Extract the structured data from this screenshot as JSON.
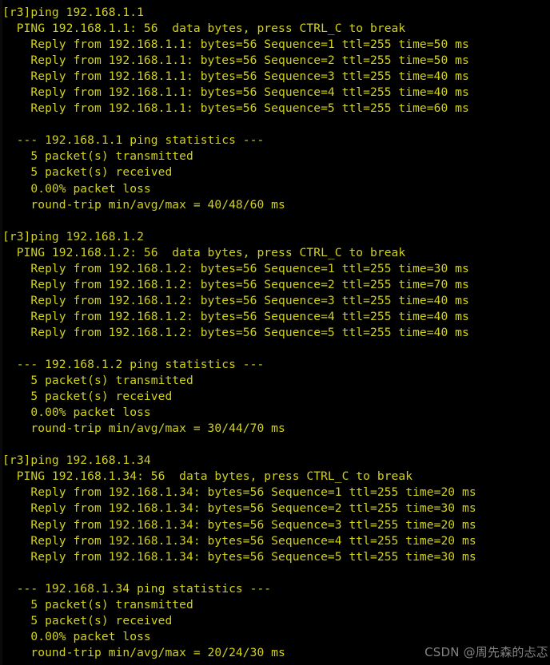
{
  "terminal": {
    "device_prompt": "[r3]",
    "foreground_color": "#d2d21d",
    "background_color": "#000000",
    "lines": [
      "[r3]ping 192.168.1.1",
      "  PING 192.168.1.1: 56  data bytes, press CTRL_C to break",
      "    Reply from 192.168.1.1: bytes=56 Sequence=1 ttl=255 time=50 ms",
      "    Reply from 192.168.1.1: bytes=56 Sequence=2 ttl=255 time=50 ms",
      "    Reply from 192.168.1.1: bytes=56 Sequence=3 ttl=255 time=40 ms",
      "    Reply from 192.168.1.1: bytes=56 Sequence=4 ttl=255 time=40 ms",
      "    Reply from 192.168.1.1: bytes=56 Sequence=5 ttl=255 time=60 ms",
      "",
      "  --- 192.168.1.1 ping statistics ---",
      "    5 packet(s) transmitted",
      "    5 packet(s) received",
      "    0.00% packet loss",
      "    round-trip min/avg/max = 40/48/60 ms",
      "",
      "[r3]ping 192.168.1.2",
      "  PING 192.168.1.2: 56  data bytes, press CTRL_C to break",
      "    Reply from 192.168.1.2: bytes=56 Sequence=1 ttl=255 time=30 ms",
      "    Reply from 192.168.1.2: bytes=56 Sequence=2 ttl=255 time=70 ms",
      "    Reply from 192.168.1.2: bytes=56 Sequence=3 ttl=255 time=40 ms",
      "    Reply from 192.168.1.2: bytes=56 Sequence=4 ttl=255 time=40 ms",
      "    Reply from 192.168.1.2: bytes=56 Sequence=5 ttl=255 time=40 ms",
      "",
      "  --- 192.168.1.2 ping statistics ---",
      "    5 packet(s) transmitted",
      "    5 packet(s) received",
      "    0.00% packet loss",
      "    round-trip min/avg/max = 30/44/70 ms",
      "",
      "[r3]ping 192.168.1.34",
      "  PING 192.168.1.34: 56  data bytes, press CTRL_C to break",
      "    Reply from 192.168.1.34: bytes=56 Sequence=1 ttl=255 time=20 ms",
      "    Reply from 192.168.1.34: bytes=56 Sequence=2 ttl=255 time=30 ms",
      "    Reply from 192.168.1.34: bytes=56 Sequence=3 ttl=255 time=20 ms",
      "    Reply from 192.168.1.34: bytes=56 Sequence=4 ttl=255 time=20 ms",
      "    Reply from 192.168.1.34: bytes=56 Sequence=5 ttl=255 time=30 ms",
      "",
      "  --- 192.168.1.34 ping statistics ---",
      "    5 packet(s) transmitted",
      "    5 packet(s) received",
      "    0.00% packet loss",
      "    round-trip min/avg/max = 20/24/30 ms"
    ],
    "sessions": [
      {
        "command": "ping 192.168.1.1",
        "target": "192.168.1.1",
        "data_bytes": "56",
        "replies": [
          {
            "sequence": "1",
            "bytes": "56",
            "ttl": "255",
            "time": "50 ms"
          },
          {
            "sequence": "2",
            "bytes": "56",
            "ttl": "255",
            "time": "50 ms"
          },
          {
            "sequence": "3",
            "bytes": "56",
            "ttl": "255",
            "time": "40 ms"
          },
          {
            "sequence": "4",
            "bytes": "56",
            "ttl": "255",
            "time": "40 ms"
          },
          {
            "sequence": "5",
            "bytes": "56",
            "ttl": "255",
            "time": "60 ms"
          }
        ],
        "statistics": {
          "transmitted": "5 packet(s) transmitted",
          "received": "5 packet(s) received",
          "loss": "0.00% packet loss",
          "round_trip": "round-trip min/avg/max = 40/48/60 ms"
        }
      },
      {
        "command": "ping 192.168.1.2",
        "target": "192.168.1.2",
        "data_bytes": "56",
        "replies": [
          {
            "sequence": "1",
            "bytes": "56",
            "ttl": "255",
            "time": "30 ms"
          },
          {
            "sequence": "2",
            "bytes": "56",
            "ttl": "255",
            "time": "70 ms"
          },
          {
            "sequence": "3",
            "bytes": "56",
            "ttl": "255",
            "time": "40 ms"
          },
          {
            "sequence": "4",
            "bytes": "56",
            "ttl": "255",
            "time": "40 ms"
          },
          {
            "sequence": "5",
            "bytes": "56",
            "ttl": "255",
            "time": "40 ms"
          }
        ],
        "statistics": {
          "transmitted": "5 packet(s) transmitted",
          "received": "5 packet(s) received",
          "loss": "0.00% packet loss",
          "round_trip": "round-trip min/avg/max = 30/44/70 ms"
        }
      },
      {
        "command": "ping 192.168.1.34",
        "target": "192.168.1.34",
        "data_bytes": "56",
        "replies": [
          {
            "sequence": "1",
            "bytes": "56",
            "ttl": "255",
            "time": "20 ms"
          },
          {
            "sequence": "2",
            "bytes": "56",
            "ttl": "255",
            "time": "30 ms"
          },
          {
            "sequence": "3",
            "bytes": "56",
            "ttl": "255",
            "time": "20 ms"
          },
          {
            "sequence": "4",
            "bytes": "56",
            "ttl": "255",
            "time": "20 ms"
          },
          {
            "sequence": "5",
            "bytes": "56",
            "ttl": "255",
            "time": "30 ms"
          }
        ],
        "statistics": {
          "transmitted": "5 packet(s) transmitted",
          "received": "5 packet(s) received",
          "loss": "0.00% packet loss",
          "round_trip": "round-trip min/avg/max = 20/24/30 ms"
        }
      }
    ]
  },
  "watermark": {
    "text": "CSDN @周先森的忐忑",
    "color": "#8f8f8f"
  }
}
